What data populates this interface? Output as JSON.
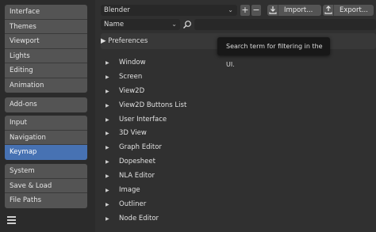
{
  "sidebar": {
    "group1": [
      "Interface",
      "Themes",
      "Viewport",
      "Lights",
      "Editing",
      "Animation"
    ],
    "group2": [
      "Add-ons"
    ],
    "group3": [
      "Input",
      "Navigation",
      "Keymap"
    ],
    "group4": [
      "System",
      "Save & Load",
      "File Paths"
    ],
    "active": "Keymap"
  },
  "toolbar": {
    "keymap_preset": "Blender",
    "add_label": "+",
    "remove_label": "−",
    "import_label": "Import...",
    "export_label": "Export..."
  },
  "filter": {
    "type": "Name",
    "search_value": ""
  },
  "tooltip": "Search term for filtering in the UI.",
  "preferences_label": "Preferences",
  "keymap_items": [
    "Window",
    "Screen",
    "View2D",
    "View2D Buttons List",
    "User Interface",
    "3D View",
    "Graph Editor",
    "Dopesheet",
    "NLA Editor",
    "Image",
    "Outliner",
    "Node Editor"
  ],
  "colors": {
    "accent": "#4772b3",
    "button": "#545454",
    "panel": "#303030",
    "field": "#282828"
  }
}
